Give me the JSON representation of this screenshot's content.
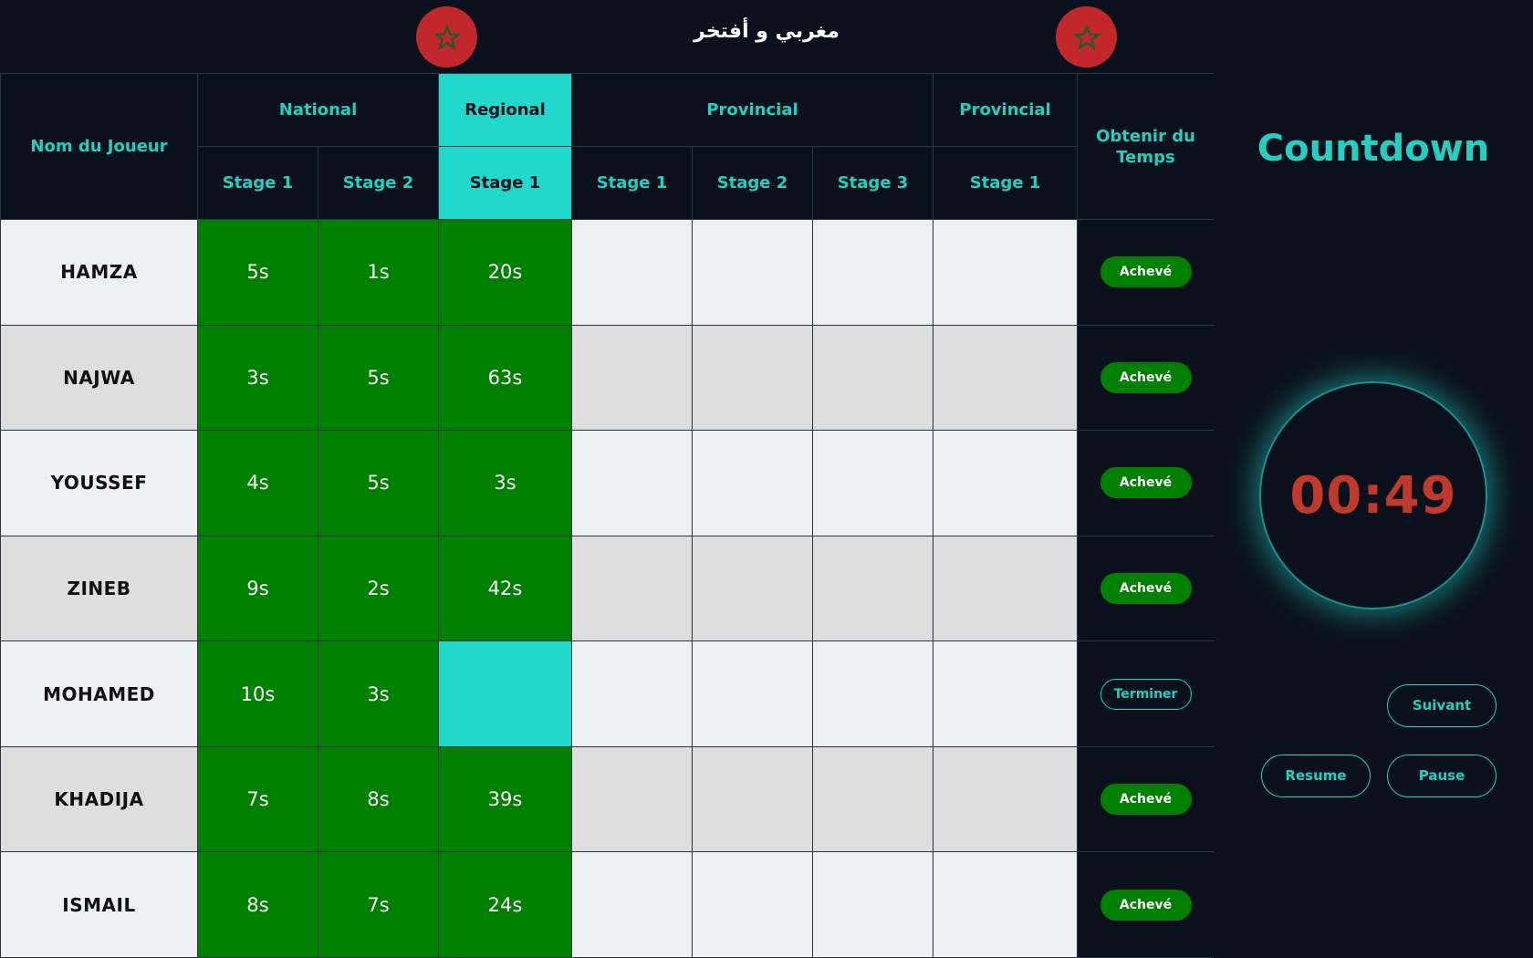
{
  "header": {
    "title": "مغربي و أفتخر",
    "flag_color": "#c1272d",
    "flag_icon": "star-icon"
  },
  "table": {
    "name_header": "Nom du Joueur",
    "time_header": "Obtenir du Temps",
    "levels": [
      {
        "label": "National",
        "highlighted": false
      },
      {
        "label": "Regional",
        "highlighted": true
      },
      {
        "label": "Provincial",
        "highlighted": false
      },
      {
        "label": "Provincial",
        "highlighted": false
      }
    ],
    "stages": [
      "Stage 1",
      "Stage 2",
      "Stage 1",
      "Stage 1",
      "Stage 2",
      "Stage 3",
      "Stage 1"
    ],
    "rows": [
      {
        "name": "HAMZA",
        "times": [
          "5s",
          "1s",
          "20s",
          "",
          "",
          "",
          ""
        ],
        "status": "Achevé"
      },
      {
        "name": "NAJWA",
        "times": [
          "3s",
          "5s",
          "63s",
          "",
          "",
          "",
          ""
        ],
        "status": "Achevé"
      },
      {
        "name": "YOUSSEF",
        "times": [
          "4s",
          "5s",
          "3s",
          "",
          "",
          "",
          ""
        ],
        "status": "Achevé"
      },
      {
        "name": "ZINEB",
        "times": [
          "9s",
          "2s",
          "42s",
          "",
          "",
          "",
          ""
        ],
        "status": "Achevé"
      },
      {
        "name": "MOHAMED",
        "times": [
          "10s",
          "3s",
          "",
          "",
          "",
          "",
          ""
        ],
        "status": "Terminer"
      },
      {
        "name": "KHADIJA",
        "times": [
          "7s",
          "8s",
          "39s",
          "",
          "",
          "",
          ""
        ],
        "status": "Achevé"
      },
      {
        "name": "ISMAIL",
        "times": [
          "8s",
          "7s",
          "24s",
          "",
          "",
          "",
          ""
        ],
        "status": "Achevé"
      }
    ],
    "colors": {
      "done": "#008000",
      "current": "#20d9cc",
      "accent": "#22cfc0"
    }
  },
  "countdown": {
    "title": "Countdown",
    "time": "00:49",
    "time_color": "#c0392b",
    "next_label": "Suivant",
    "resume_label": "Resume",
    "pause_label": "Pause"
  }
}
